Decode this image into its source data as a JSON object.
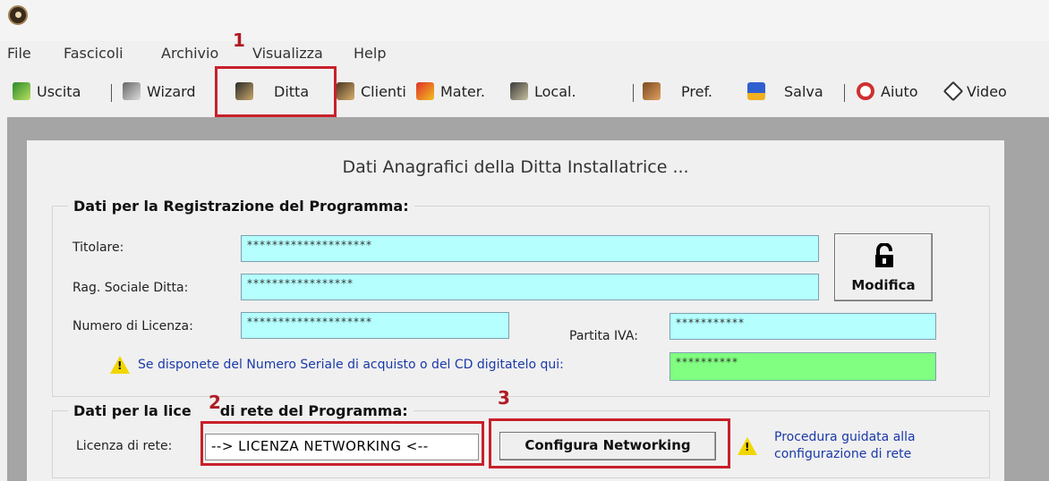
{
  "menu": [
    "File",
    "Fascicoli",
    "Archivio",
    "Visualizza",
    "Help"
  ],
  "toolbar": [
    {
      "label": "Uscita",
      "icon": "exit-icon"
    },
    {
      "label": "Wizard",
      "icon": "wizard-icon"
    },
    {
      "label": "Ditta",
      "icon": "company-icon"
    },
    {
      "label": "Clienti",
      "icon": "clients-icon"
    },
    {
      "label": "Mater.",
      "icon": "materials-icon"
    },
    {
      "label": "Local.",
      "icon": "locations-icon"
    },
    {
      "label": "Pref.",
      "icon": "preferences-icon"
    },
    {
      "label": "Salva",
      "icon": "save-icon"
    },
    {
      "label": "Aiuto",
      "icon": "help-icon"
    },
    {
      "label": "Video",
      "icon": "video-icon"
    }
  ],
  "panel": {
    "title": "Dati Anagrafici della Ditta Installatrice ...",
    "registration": {
      "title": "Dati per la Registrazione del Programma:",
      "titolare_label": "Titolare:",
      "titolare_value": "********************",
      "rag_label": "Rag. Sociale Ditta:",
      "rag_value": "*****************",
      "licenza_label": "Numero di Licenza:",
      "licenza_value": "********************",
      "piva_label": "Partita IVA:",
      "piva_value": "***********",
      "serial_note": "Se disponete del Numero Seriale di acquisto o del CD digitatelo qui:",
      "serial_value": "**********",
      "modify_button": "Modifica"
    },
    "network": {
      "title_part1": "Dati per la lice",
      "title_part2": "di rete del Programma:",
      "license_label": "Licenza di rete:",
      "license_value": "--> LICENZA NETWORKING  <--",
      "configure_button": "Configura Networking",
      "wizard_note_line1": "Procedura guidata alla",
      "wizard_note_line2": "configurazione di rete"
    }
  },
  "annotations": [
    "1",
    "2",
    "3"
  ],
  "colors": {
    "accent_red": "#c8202a",
    "field_cyan": "#b5ffff",
    "field_green": "#80ff80",
    "link_blue": "#1a3aa8"
  }
}
